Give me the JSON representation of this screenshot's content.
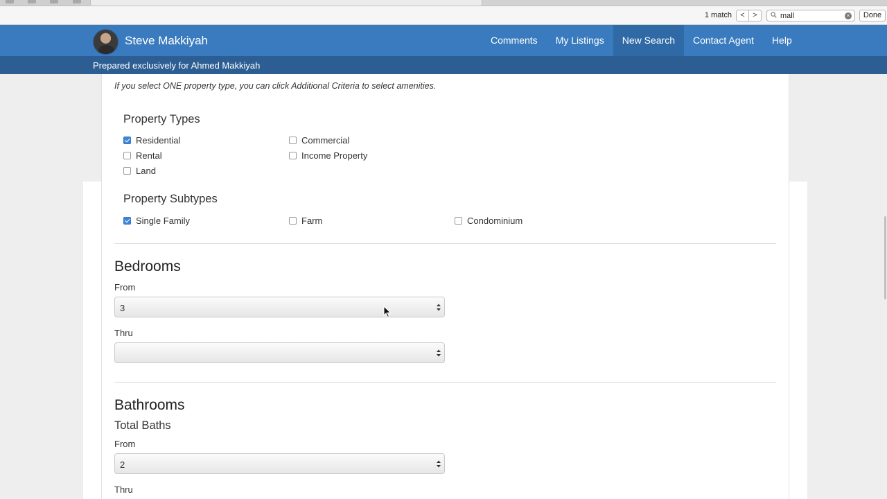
{
  "find_bar": {
    "match_count": "1 match",
    "prev_label": "<",
    "next_label": ">",
    "query": "mall",
    "done_label": "Done"
  },
  "header": {
    "agent_name": "Steve Makkiyah",
    "prepared_for": "Prepared exclusively for Ahmed Makkiyah",
    "nav": [
      "Comments",
      "My Listings",
      "New Search",
      "Contact Agent",
      "Help"
    ],
    "active_nav": "New Search",
    "accent_color": "#3a7bbf",
    "subbar_color": "#2d5e93"
  },
  "form": {
    "note": "If you select ONE property type, you can click Additional Criteria to select amenities.",
    "property_types": {
      "heading": "Property Types",
      "options": [
        {
          "label": "Residential",
          "checked": true
        },
        {
          "label": "Commercial",
          "checked": false
        },
        {
          "label": "Rental",
          "checked": false
        },
        {
          "label": "Income Property",
          "checked": false
        },
        {
          "label": "Land",
          "checked": false
        }
      ]
    },
    "property_subtypes": {
      "heading": "Property Subtypes",
      "options": [
        {
          "label": "Single Family",
          "checked": true
        },
        {
          "label": "Farm",
          "checked": false
        },
        {
          "label": "Condominium",
          "checked": false
        }
      ]
    },
    "bedrooms": {
      "heading": "Bedrooms",
      "from_label": "From",
      "from_value": "3",
      "thru_label": "Thru",
      "thru_value": ""
    },
    "bathrooms": {
      "heading": "Bathrooms",
      "subheading": "Total Baths",
      "from_label": "From",
      "from_value": "2",
      "thru_label": "Thru"
    }
  }
}
